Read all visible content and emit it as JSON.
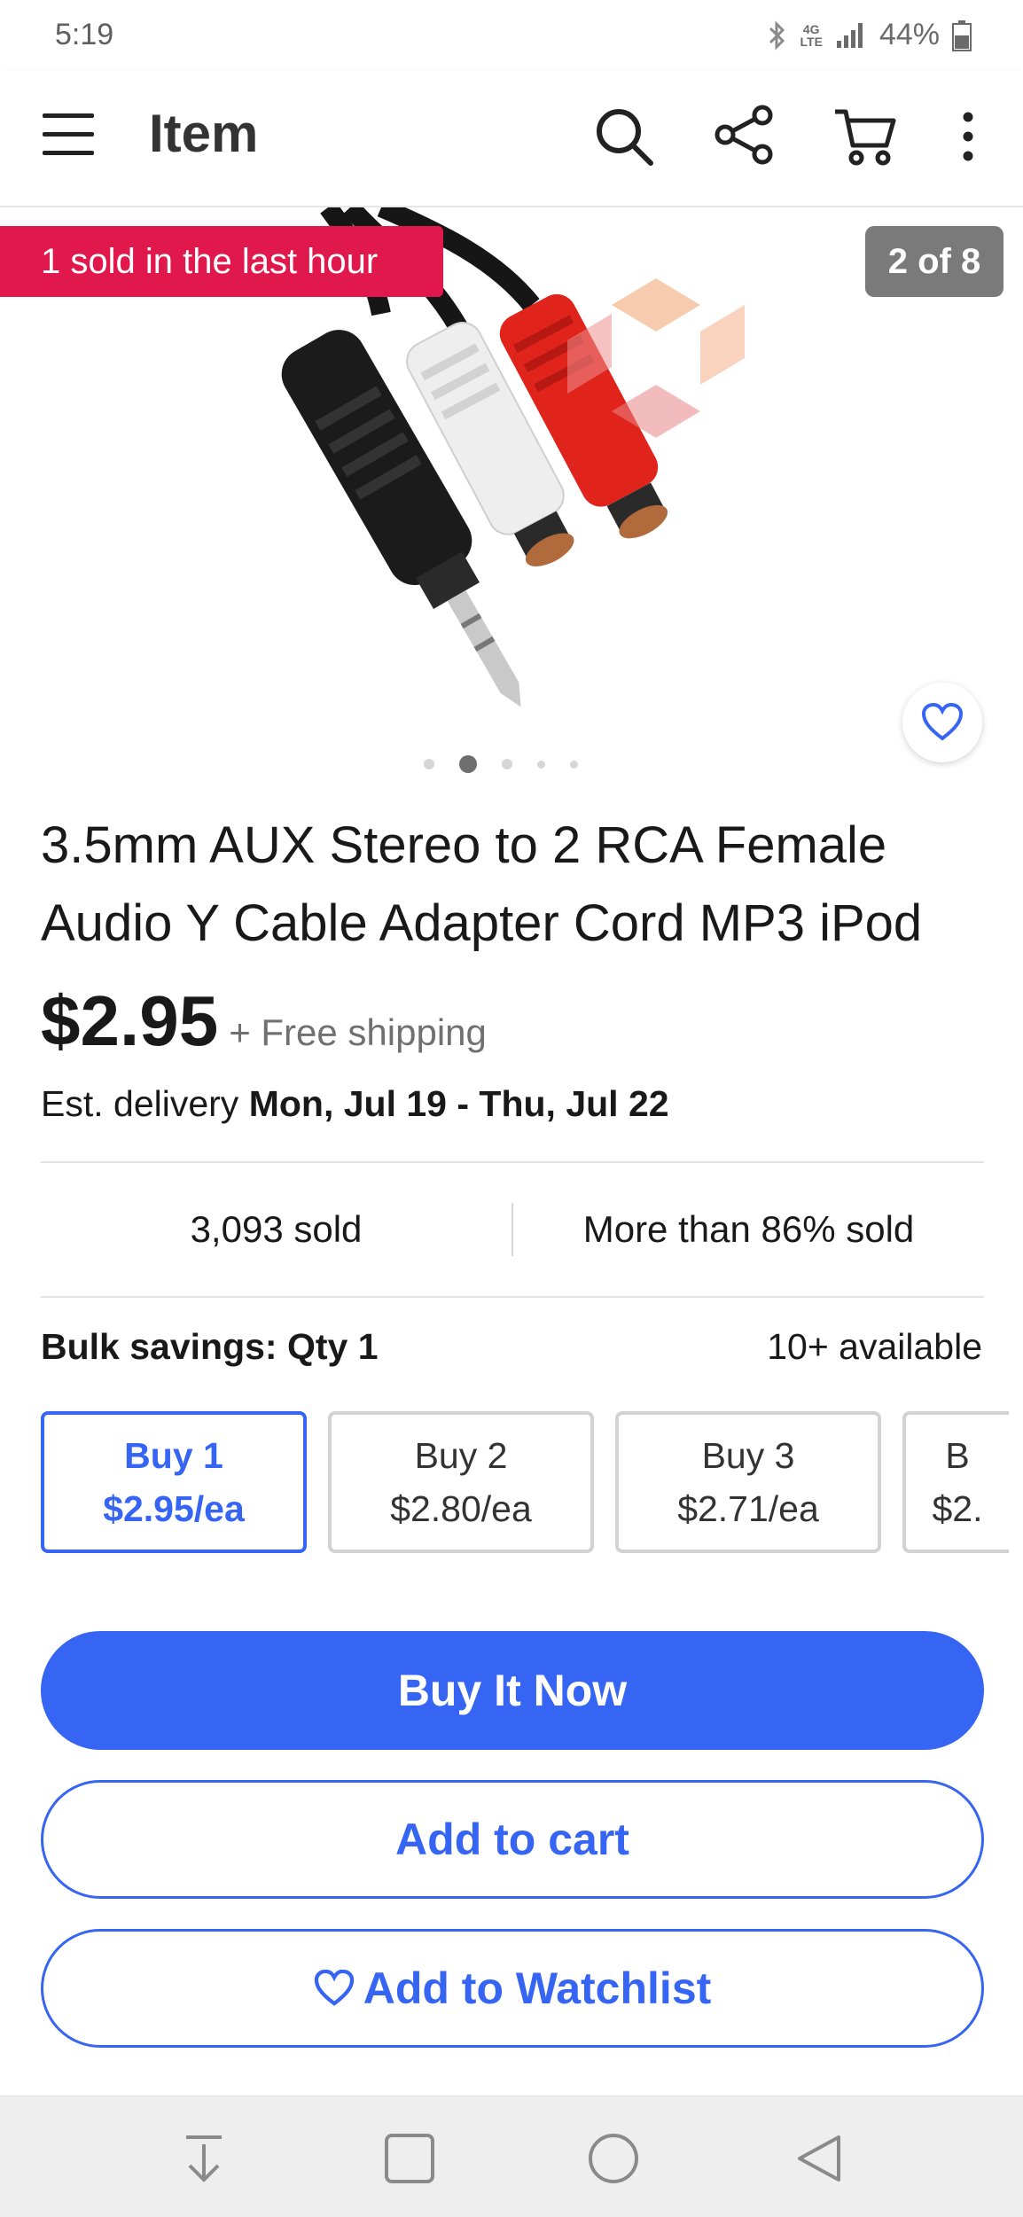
{
  "status_bar": {
    "time": "5:19",
    "network": "4G LTE",
    "battery": "44%"
  },
  "app_bar": {
    "title": "Item"
  },
  "gallery": {
    "sold_badge": "1 sold in the last hour",
    "counter": "2 of 8"
  },
  "product": {
    "title": "3.5mm AUX Stereo to 2 RCA Female Audio Y Cable Adapter Cord MP3 iPod",
    "price": "$2.95",
    "shipping": "+ Free shipping",
    "delivery_label": "Est. delivery",
    "delivery_dates": "Mon, Jul 19 - Thu, Jul 22"
  },
  "stats": {
    "sold": "3,093 sold",
    "percent_sold": "More than 86% sold"
  },
  "bulk": {
    "label": "Bulk savings: Qty 1",
    "available": "10+ available",
    "options": [
      {
        "qty": "Buy 1",
        "price": "$2.95/ea"
      },
      {
        "qty": "Buy 2",
        "price": "$2.80/ea"
      },
      {
        "qty": "Buy 3",
        "price": "$2.71/ea"
      },
      {
        "qty": "B",
        "price": "$2."
      }
    ]
  },
  "actions": {
    "buy_now": "Buy It Now",
    "add_cart": "Add to cart",
    "add_watchlist": "Add to Watchlist"
  },
  "colors": {
    "accent": "#3665f3",
    "badge": "#e0184b"
  }
}
